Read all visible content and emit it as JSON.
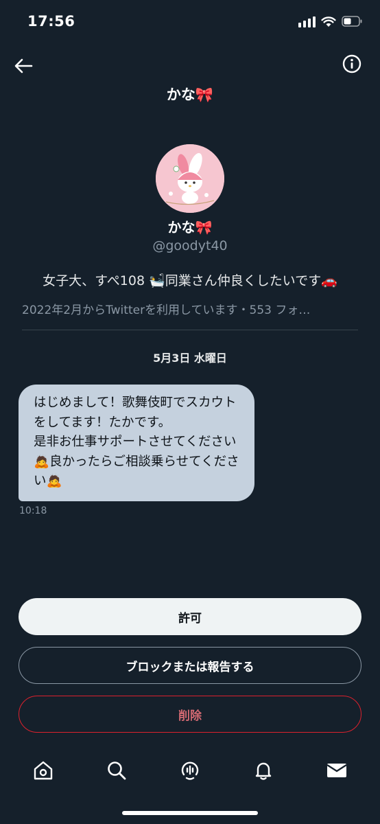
{
  "status_bar": {
    "time": "17:56",
    "icons": [
      "signal-icon",
      "wifi-icon",
      "battery-icon"
    ]
  },
  "header": {
    "title": "かな🎀",
    "back_icon": "arrow-left-icon",
    "info_icon": "info-circle-icon"
  },
  "profile": {
    "name": "かな🎀",
    "handle": "@goodyt40",
    "bio": "女子大、すぺ108 🛀同業さん仲良くしたいです🚗",
    "meta": "2022年2月からTwitterを利用しています・553 フォ…"
  },
  "conversation": {
    "date_label": "5月3日 水曜日",
    "messages": [
      {
        "text": "はじめまして！歌舞伎町でスカウトをしてます！たかです。\n是非お仕事サポートさせてください🙇良かったらご相談乗らせてください🙇",
        "time": "10:18"
      }
    ]
  },
  "actions": {
    "allow_label": "許可",
    "block_report_label": "ブロックまたは報告する",
    "delete_label": "削除"
  },
  "bottom_nav": {
    "items": [
      "home-icon",
      "search-icon",
      "spaces-icon",
      "notifications-icon",
      "messages-icon"
    ]
  },
  "colors": {
    "background": "#15202b",
    "bubble": "#c5d1de",
    "delete": "#f4212e",
    "muted_text": "#8b98a5"
  }
}
